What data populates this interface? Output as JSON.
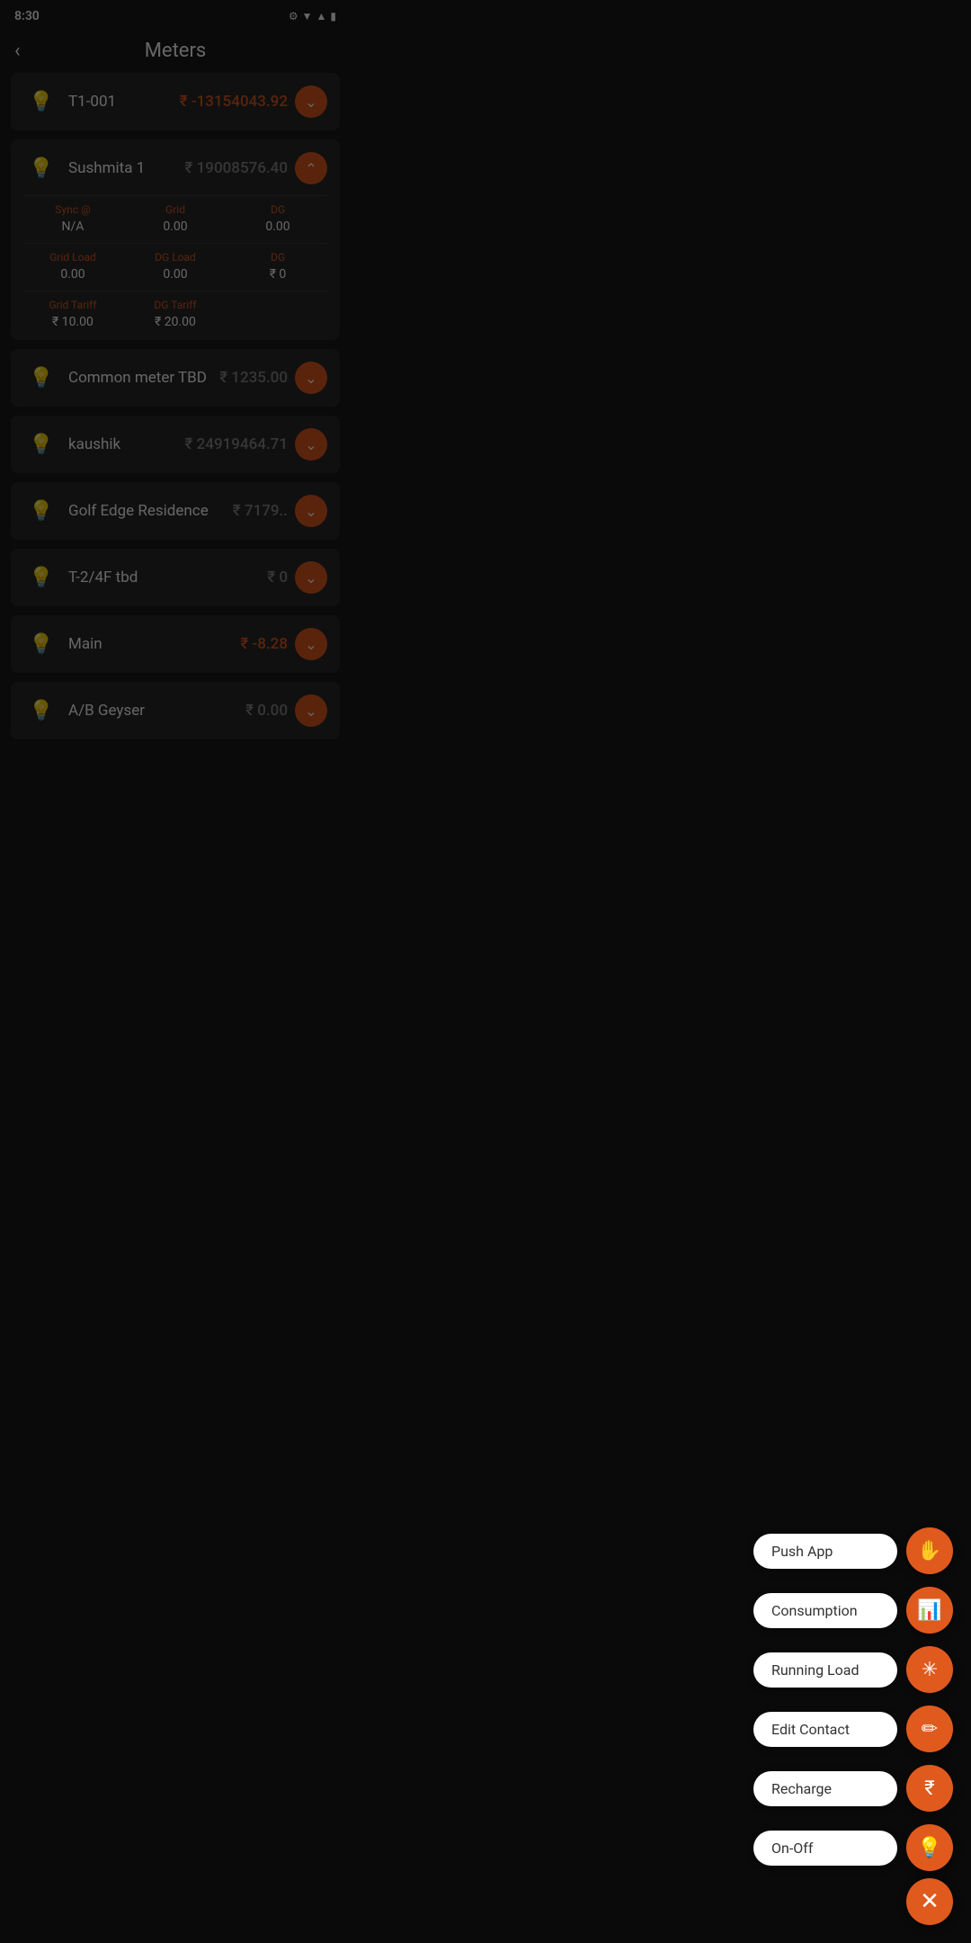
{
  "statusBar": {
    "time": "8:30",
    "icons": [
      "⚙",
      "📶",
      "▲",
      "🔋"
    ]
  },
  "header": {
    "title": "Meters",
    "backLabel": "‹"
  },
  "meters": [
    {
      "id": "T1-001",
      "name": "T1-001",
      "value": "₹ -13154043.92",
      "valueType": "negative",
      "chevron": "down",
      "expanded": false
    },
    {
      "id": "sushmita-1",
      "name": "Sushmita 1",
      "value": "₹ 19008576.40",
      "valueType": "zero",
      "chevron": "up",
      "expanded": true,
      "subRows": [
        {
          "label": "Sync @",
          "value": "N/A"
        },
        {
          "label": "Grid",
          "value": "0.00"
        },
        {
          "label": "DG",
          "value": "0.00"
        }
      ],
      "subRows2": [
        {
          "label": "Grid Load",
          "value": "0.00"
        },
        {
          "label": "DG Load",
          "value": "0.00"
        },
        {
          "label": "DG",
          "value": "₹ 0"
        }
      ],
      "subRows3": [
        {
          "label": "Grid Tariff",
          "value": "₹ 10.00"
        },
        {
          "label": "DG Tariff",
          "value": "₹ 20.00"
        },
        {
          "label": "",
          "value": ""
        }
      ]
    },
    {
      "id": "common-meter-tbd",
      "name": "Common meter TBD",
      "value": "₹ 1235.00",
      "valueType": "zero",
      "chevron": "down",
      "expanded": false
    },
    {
      "id": "kaushik",
      "name": "kaushik",
      "value": "₹ 24919464.71",
      "valueType": "zero",
      "chevron": "down",
      "expanded": false
    },
    {
      "id": "golf-edge",
      "name": "Golf Edge Residence",
      "value": "₹ 7179..",
      "valueType": "zero",
      "chevron": "down",
      "expanded": false
    },
    {
      "id": "t2-4f-tbd",
      "name": "T-2/4F tbd",
      "value": "₹ 0",
      "valueType": "zero",
      "chevron": "down",
      "expanded": false
    },
    {
      "id": "main",
      "name": "Main",
      "value": "₹ -8.28",
      "valueType": "negative",
      "chevron": "down",
      "expanded": false
    },
    {
      "id": "ab-geyser",
      "name": "A/B Geyser",
      "value": "₹ 0.00",
      "valueType": "zero",
      "chevron": "down",
      "expanded": false
    }
  ],
  "fabMenu": {
    "items": [
      {
        "id": "push-app",
        "label": "Push App",
        "icon": "✋"
      },
      {
        "id": "consumption",
        "label": "Consumption",
        "icon": "📊"
      },
      {
        "id": "running-load",
        "label": "Running Load",
        "icon": "✳"
      },
      {
        "id": "edit-contact",
        "label": "Edit Contact",
        "icon": "✏"
      },
      {
        "id": "recharge",
        "label": "Recharge",
        "icon": "₹"
      },
      {
        "id": "on-off",
        "label": "On-Off",
        "icon": "💡"
      }
    ],
    "closeIcon": "✕"
  }
}
